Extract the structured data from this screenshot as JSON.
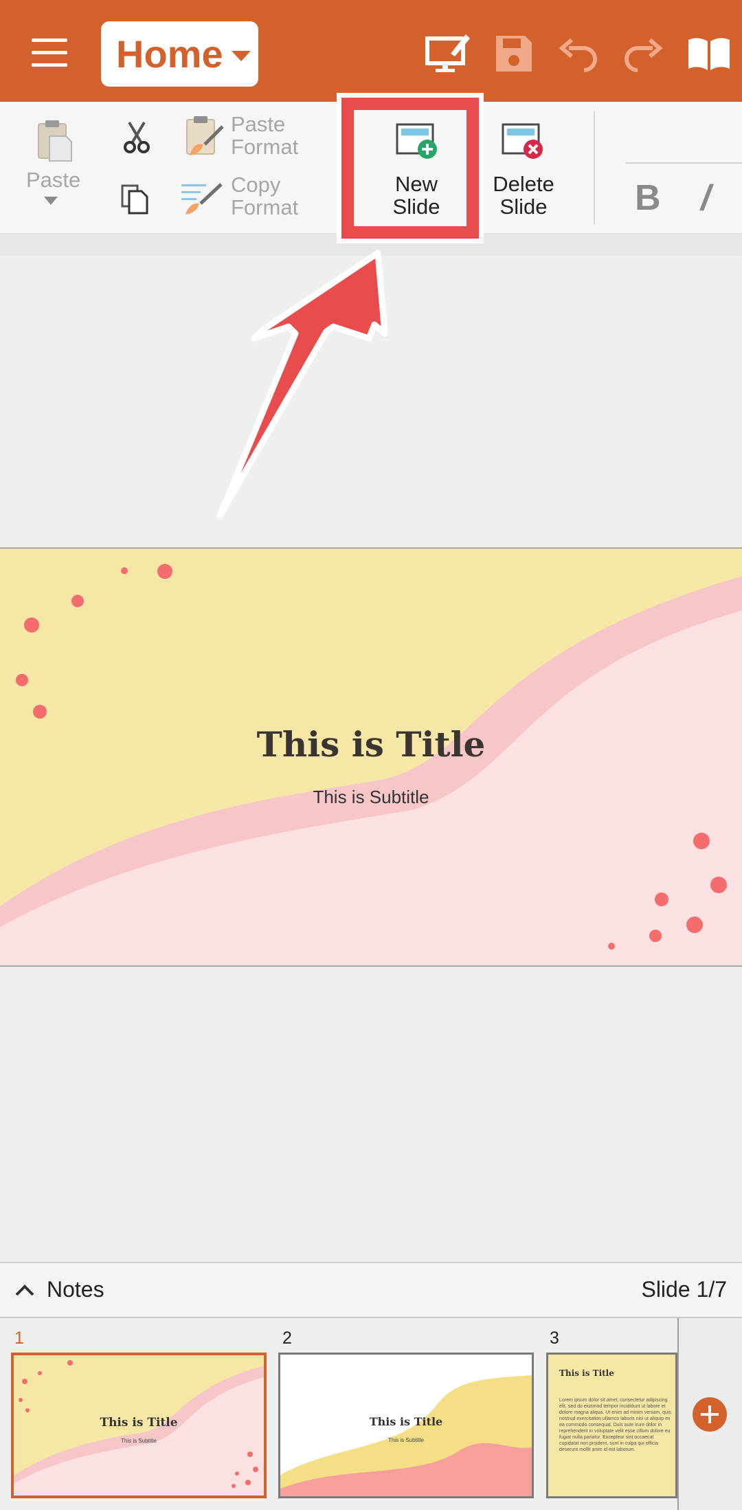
{
  "app_bar": {
    "menu_icon": "hamburger-menu-icon",
    "tab_label": "Home",
    "icons": [
      "present-icon",
      "save-icon",
      "undo-icon",
      "redo-icon",
      "read-mode-icon"
    ],
    "color": "#d2612b"
  },
  "ribbon": {
    "paste_label": "Paste",
    "paste_format_line1": "Paste",
    "paste_format_line2": "Format",
    "copy_format_line1": "Copy",
    "copy_format_line2": "Format",
    "new_slide_line1": "New",
    "new_slide_line2": "Slide",
    "delete_slide_line1": "Delete",
    "delete_slide_line2": "Slide",
    "bold_label": "B",
    "italic_label": "/"
  },
  "slide": {
    "title": "This is Title",
    "subtitle": "This is Subtitle"
  },
  "notes_bar": {
    "label": "Notes",
    "counter": "Slide 1/7"
  },
  "thumbnails": [
    {
      "number": "1",
      "title": "This is Title",
      "subtitle": "This is Subtitle",
      "selected": true
    },
    {
      "number": "2",
      "title": "This is Title",
      "subtitle": "This is Subtitle",
      "selected": false
    },
    {
      "number": "3",
      "title": "This is Title",
      "body": "Lorem ipsum dolor sit amet, consectetur adipiscing elit, sed do eiusmod tempor incididunt ut labore et dolore magna aliqua. Ut enim ad minim veniam, quis nostrud exercitation ullamco laboris nisi ut aliquip ex ea commodo consequat. Duis aute irure dolor in reprehenderit in voluptate velit esse cillum dolore eu fugiat nulla pariatur. Excepteur sint occaecat cupidatat non proident, sunt in culpa qui officia deserunt mollit anim id est laborum.",
      "selected": false
    }
  ],
  "colors": {
    "accent": "#d2612b",
    "highlight": "#e84c4c",
    "slide_yellow": "#f7e7a6",
    "slide_pink": "#fbe1e2",
    "slide_band": "#f6c6c8",
    "dots": "#f36d6d"
  }
}
